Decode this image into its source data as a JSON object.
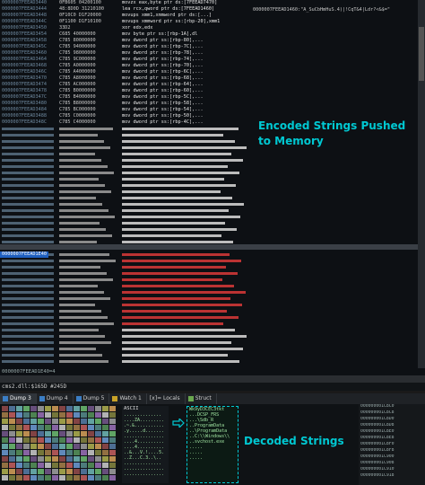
{
  "disasm": {
    "addresses": [
      "0000007FEEAD3440",
      "0000007FEEAD3444",
      "0000007FEEAD3448",
      "0000007FEEAD344C",
      "0000007FEEAD3450",
      "0000007FEEAD3454",
      "0000007FEEAD3458",
      "0000007FEEAD345C",
      "0000007FEEAD3460",
      "0000007FEEAD3464",
      "0000007FEEAD3468",
      "0000007FEEAD346C",
      "0000007FEEAD3470",
      "0000007FEEAD3474",
      "0000007FEEAD3478",
      "0000007FEEAD347C",
      "0000007FEEAD3480",
      "0000007FEEAD3484",
      "0000007FEEAD3488",
      "0000007FEEAD348C"
    ],
    "bytes": [
      "0FB605 04200100",
      "48:8D0D 31210100",
      "0F10C0 D1F20000",
      "0F1100 D1F10100",
      "33D2",
      "C685 40000000",
      "C785 80000000",
      "C785 94000000",
      "C785 98000000",
      "C785 9C000000",
      "C785 A0000000",
      "C785 A4000000",
      "C785 A8000000",
      "C785 AC000000",
      "C785 B0000000",
      "C785 B4000000",
      "C785 B8000000",
      "C785 BC000000",
      "C785 C0000000",
      "C785 C4000000"
    ],
    "instructions": [
      "movzx eax,byte ptr ds:[7FEEAD7470]",
      "lea rcx,qword ptr ds:[7FEEAD1460]",
      "movups xmm1,xmmword ptr ds:[...]",
      "movups xmmword ptr ss:[rbp-20],xmm1",
      "xor edx,edx",
      "mov byte ptr ss:[rbp-1A],dl",
      "mov dword ptr ss:[rbp-80],...",
      "mov dword ptr ss:[rbp-7C],...",
      "mov dword ptr ss:[rbp-78],...",
      "mov dword ptr ss:[rbp-74],...",
      "mov dword ptr ss:[rbp-70],...",
      "mov dword ptr ss:[rbp-6C],...",
      "mov dword ptr ss:[rbp-68],...",
      "mov dword ptr ss:[rbp-64],...",
      "mov dword ptr ss:[rbp-60],...",
      "mov dword ptr ss:[rbp-5C],...",
      "mov dword ptr ss:[rbp-58],...",
      "mov dword ptr ss:[rbp-54],...",
      "mov dword ptr ss:[rbp-50],...",
      "mov dword ptr ss:[rbp-4C],..."
    ],
    "selected_address": "0000007FEEAD1E40",
    "comment_line": "0000007FEEAD1460:\"A_SuCbHmHuS.4)|!CqT&4|Ldr?<&$=\""
  },
  "label_encoded": "Encoded Strings Pushed to Memory",
  "label_decoded": "Decoded Strings",
  "status_line_1": "0000007FEEAD1E40=4",
  "status_line_2": "cms2.dll:$165D #245D",
  "tabs": [
    {
      "label": "Dump 3"
    },
    {
      "label": "Dump 4"
    },
    {
      "label": "Dump 5"
    },
    {
      "label": "Watch 1"
    },
    {
      "label": "[x]= Locals"
    },
    {
      "label": "Struct"
    }
  ],
  "dump": {
    "ascii_header": "ASCII",
    "ascii_text": "..............\n....ZA.........\n.~.&...........\n.y.....d.......\n...............\n....4..........\n....4..........\n..&...V.!....5.\n..Z...C.3..\\..\n..............\n...............\n...............",
    "decoded_text": "Wk9yD3CEC3tkt\n...DCSP_FRS\n...\\Sdb_R\n..ProgramData\n..\\ProgramData\n..C:\\\\Windows\\\\\n..svchost.exe\n.....\n.....\n.....",
    "stack_rows": [
      "000000001C8C0",
      "000000001C8C8",
      "000000001C8D0",
      "000000001C8D8",
      "000000001C8E0",
      "000000001C8E8",
      "000000001C8F0",
      "000000001C8F8",
      "000000001C900",
      "000000001C908",
      "000000001C910",
      "000000001C918"
    ]
  },
  "colors": {
    "accent_label": "#00c8d2",
    "call_highlight": "#d8323a",
    "addr_highlight": "#1f5fbf"
  }
}
